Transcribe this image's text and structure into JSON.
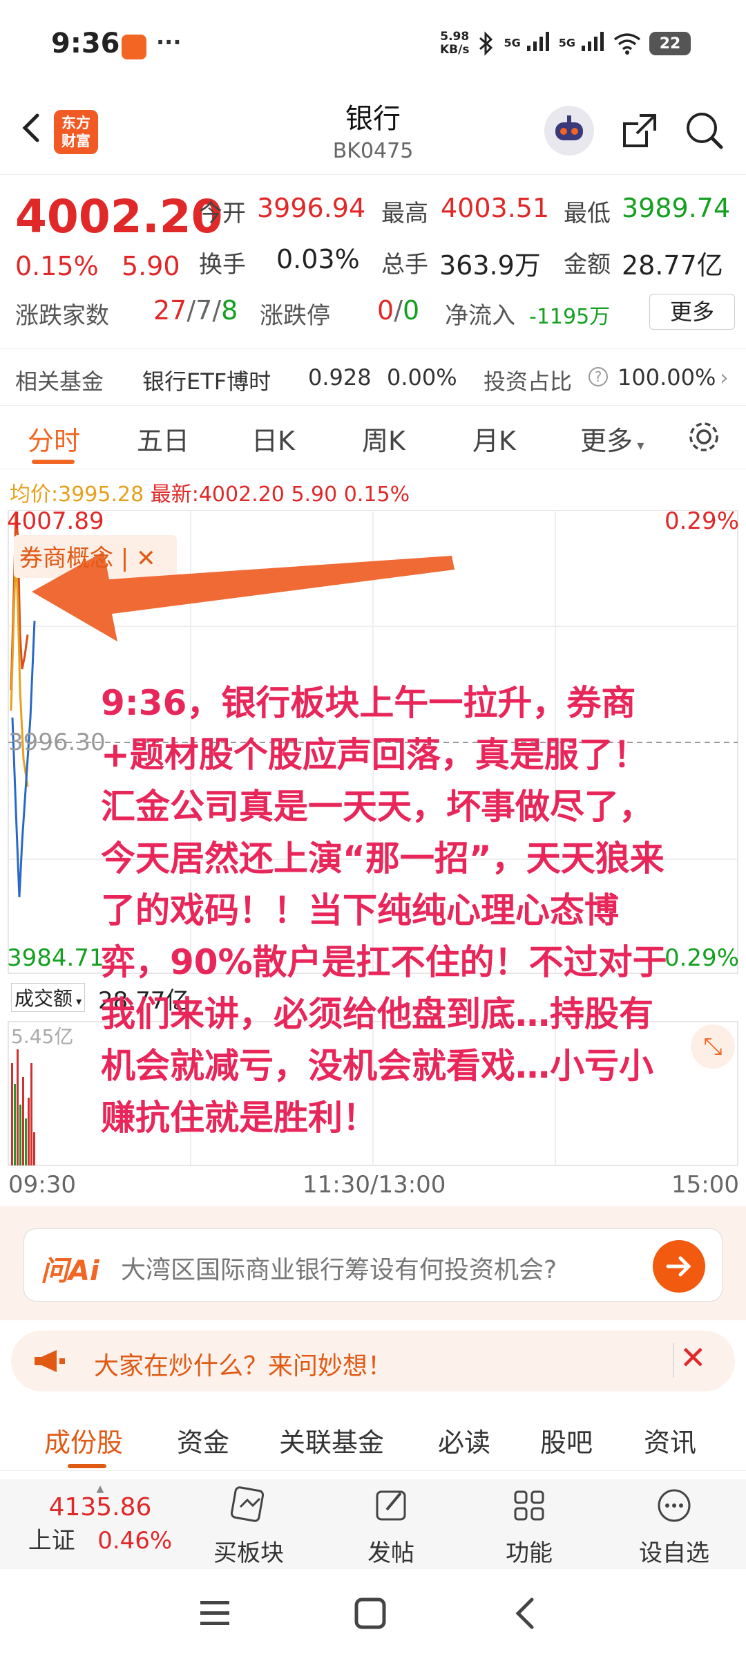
{
  "status": {
    "time": "9:36",
    "speed_value": "5.98",
    "speed_unit": "KB/s",
    "net1": "5G",
    "net2": "5G",
    "battery": "22"
  },
  "header": {
    "logo_line1": "东方",
    "logo_line2": "财富",
    "title": "银行",
    "code": "BK0475"
  },
  "quote": {
    "price": "4002.20",
    "pct": "0.15%",
    "change": "5.90",
    "open_label": "今开",
    "open": "3996.94",
    "high_label": "最高",
    "high": "4003.51",
    "low_label": "最低",
    "low": "3989.74",
    "turnover_label": "换手",
    "turnover": "0.03%",
    "volume_label": "总手",
    "volume": "363.9万",
    "amount_label": "金额",
    "amount": "28.77亿",
    "breadth_label": "涨跌家数",
    "up": "27",
    "flat": "7",
    "down": "8",
    "limit_label": "涨跌停",
    "limit_up": "0",
    "limit_down": "0",
    "netflow_label": "净流入",
    "netflow": "-1195万",
    "more": "更多"
  },
  "fund": {
    "label": "相关基金",
    "name": "银行ETF博时",
    "price": "0.928",
    "pct": "0.00%",
    "ratio_label": "投资占比",
    "ratio": "100.00%"
  },
  "chart_tabs": [
    "分时",
    "五日",
    "日K",
    "周K",
    "月K",
    "更多"
  ],
  "avg": {
    "avg_label": "均价:",
    "avg": "3995.28",
    "latest_label": "最新:",
    "latest": "4002.20",
    "chg": "5.90",
    "pct": "0.15%"
  },
  "chart_data": {
    "type": "line",
    "y_top": "4007.89",
    "y_mid": "3996.30",
    "y_bottom": "3984.71",
    "pct_top": "0.29%",
    "pct_bottom": "-0.29%",
    "tag": "券商概念",
    "volume_label": "成交额",
    "volume_total": "28.77亿",
    "volume_max": "5.45亿",
    "x_labels": [
      "09:30",
      "11:30/13:00",
      "15:00"
    ]
  },
  "annotation": "9:36，银行板块上午一拉升，券商+题材股个股应声回落，真是服了！汇金公司真是一天天，坏事做尽了，今天居然还上演“那一招”，天天狼来了的戏码！！当下纯纯心理心态博弈，90%散户是扛不住的！不过对于我们来讲，必须给他盘到底…持股有机会就减亏，没机会就看戏…小亏小赚抗住就是胜利！",
  "ai": {
    "logo": "问Ai",
    "prompt": "大湾区国际商业银行筹设有何投资机会?"
  },
  "notice": {
    "text": "大家在炒什么？来问妙想！"
  },
  "bottom_tabs": [
    "成份股",
    "资金",
    "关联基金",
    "必读",
    "股吧",
    "资讯"
  ],
  "toolbar": {
    "index_value": "4135.86",
    "index_name": "上证",
    "index_pct": "0.46%",
    "buy": "买板块",
    "post": "发帖",
    "func": "功能",
    "watch": "设自选"
  }
}
